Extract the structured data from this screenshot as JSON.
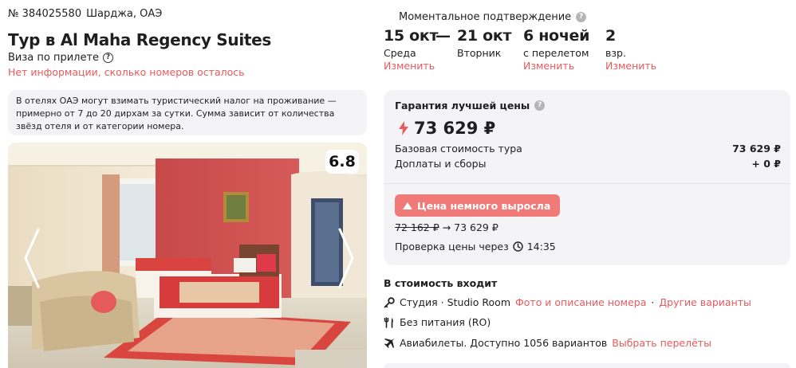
{
  "header": {
    "tour_number": "№ 384025580",
    "location": "Шарджа, ОАЭ",
    "title": "Тур в Al Maha Regency Suites",
    "visa": "Виза по прилете",
    "rooms_info": "Нет информации, сколько номеров осталось"
  },
  "notice": {
    "text": "В отелях ОАЭ могут взимать туристический налог на проживание — примерно от 7 до 20 дирхам за сутки. Сумма зависит от количества звёзд отеля и от категории номера."
  },
  "gallery": {
    "rating": "6.8",
    "prev_icon": "chevron-left-icon",
    "next_icon": "chevron-right-icon"
  },
  "booking": {
    "confirmation": "Моментальное подтверждение",
    "date_from": "15 окт",
    "day_from": "Среда",
    "date_to": "21 окт",
    "day_to": "Вторник",
    "nights": "6 ночей",
    "nights_note": "с перелетом",
    "adults": "2",
    "adults_label": "взр.",
    "change_label": "Изменить"
  },
  "price": {
    "guarantee": "Гарантия лучшей цены",
    "total": "73 629 ₽",
    "base_label": "Базовая стоимость тура",
    "base_value": "73 629 ₽",
    "fees_label": "Доплаты и сборы",
    "fees_value": "+ 0 ₽",
    "rise_button": "Цена немного выросла",
    "old_price": "72 162 ₽",
    "arrow": "→",
    "new_price": "73 629 ₽",
    "check_label": "Проверка цены через",
    "check_time": "14:35"
  },
  "includes": {
    "title": "В стоимость входит",
    "room": "Студия · Studio Room",
    "room_link": "Фото и описание номера",
    "sep": "·",
    "room_other": "Другие варианты",
    "meal": "Без питания (RO)",
    "flights": "Авиабилеты. Доступно 1056 вариантов",
    "flights_link": "Выбрать перелёты"
  },
  "colors": {
    "accent": "#e9595d",
    "button": "#f07a78",
    "panel": "#f4f4f6"
  }
}
